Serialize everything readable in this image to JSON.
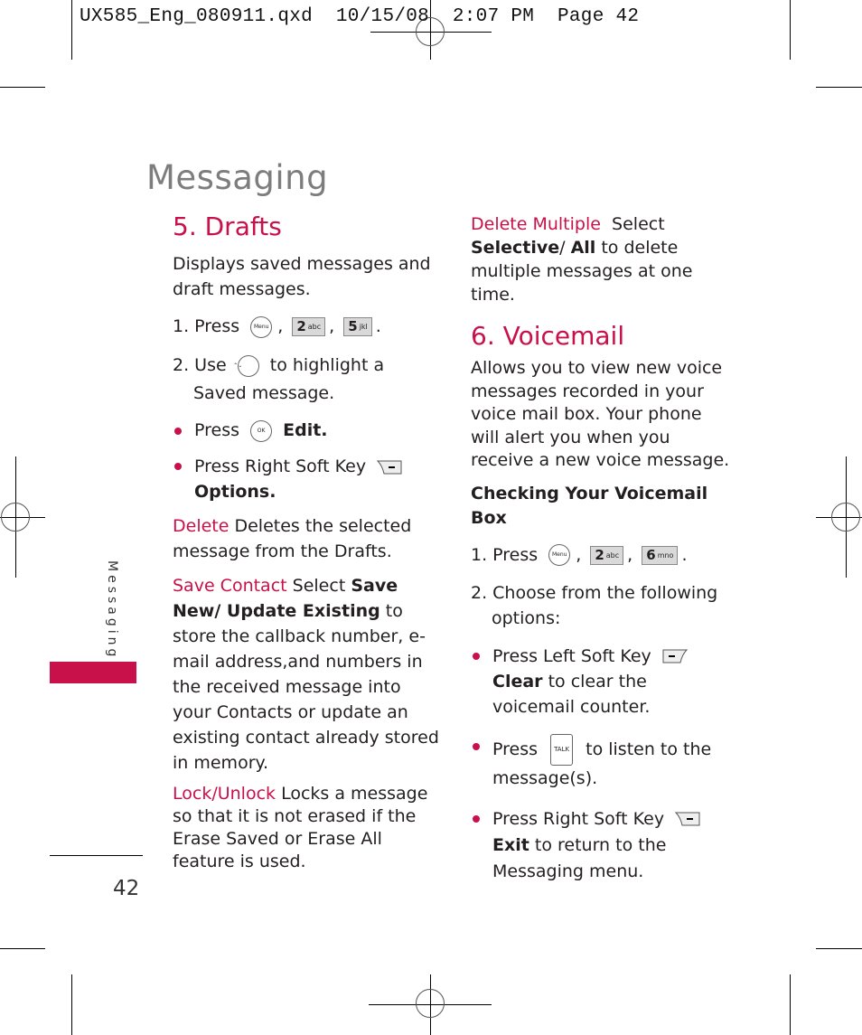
{
  "slug": "UX585_Eng_080911.qxd  10/15/08  2:07 PM  Page 42",
  "page_title": "Messaging",
  "side_tab_label": "Messaging",
  "page_number": "42",
  "accent_color": "#c8104a",
  "drafts": {
    "heading": "5. Drafts",
    "intro": "Displays saved messages and draft messages.",
    "step1_prefix": "1. Press",
    "step1_keys": [
      "Menu",
      "2 abc",
      "5 jkl"
    ],
    "step2_prefix": "2. Use",
    "step2_suffix": "to highlight a Saved message.",
    "bullets": [
      {
        "prefix": "Press",
        "key": "OK",
        "action": "Edit."
      },
      {
        "prefix": "Press Right Soft Key",
        "key": "right-soft-key",
        "action": "Options."
      }
    ],
    "options": [
      {
        "term": "Delete",
        "text": "Deletes the selected message from the Drafts."
      },
      {
        "term": "Save Contact",
        "text_pre": "Select",
        "bold1": "Save New/ Update Existing",
        "text": "to store the callback number, e-mail address,and numbers in the received message into your Contacts or update an existing contact already stored in memory."
      },
      {
        "term": "Lock/Unlock",
        "text": "Locks a message so that it is not erased if the Erase Saved or Erase All feature is used."
      }
    ]
  },
  "delete_multiple": {
    "term": "Delete Multiple",
    "text_pre": "Select",
    "bold1": "Selective",
    "bold2": "All",
    "text": "to delete multiple messages at one time."
  },
  "voicemail": {
    "heading": "6. Voicemail",
    "intro": "Allows you to view new voice messages recorded in your voice mail box. Your phone will alert you when you receive a new voice message.",
    "subheading": "Checking Your Voicemail Box",
    "step1_prefix": "1. Press",
    "step1_keys": [
      "Menu",
      "2 abc",
      "6 mno"
    ],
    "step2": "2. Choose from the following options:",
    "bullets": [
      {
        "prefix": "Press Left Soft Key",
        "action": "Clear",
        "suffix": "to clear the voicemail counter."
      },
      {
        "prefix": "Press",
        "key": "TALK",
        "suffix": "to listen to the message(s)."
      },
      {
        "prefix": "Press Right Soft Key",
        "action": "Exit",
        "suffix": "to return to the Messaging menu."
      }
    ]
  }
}
